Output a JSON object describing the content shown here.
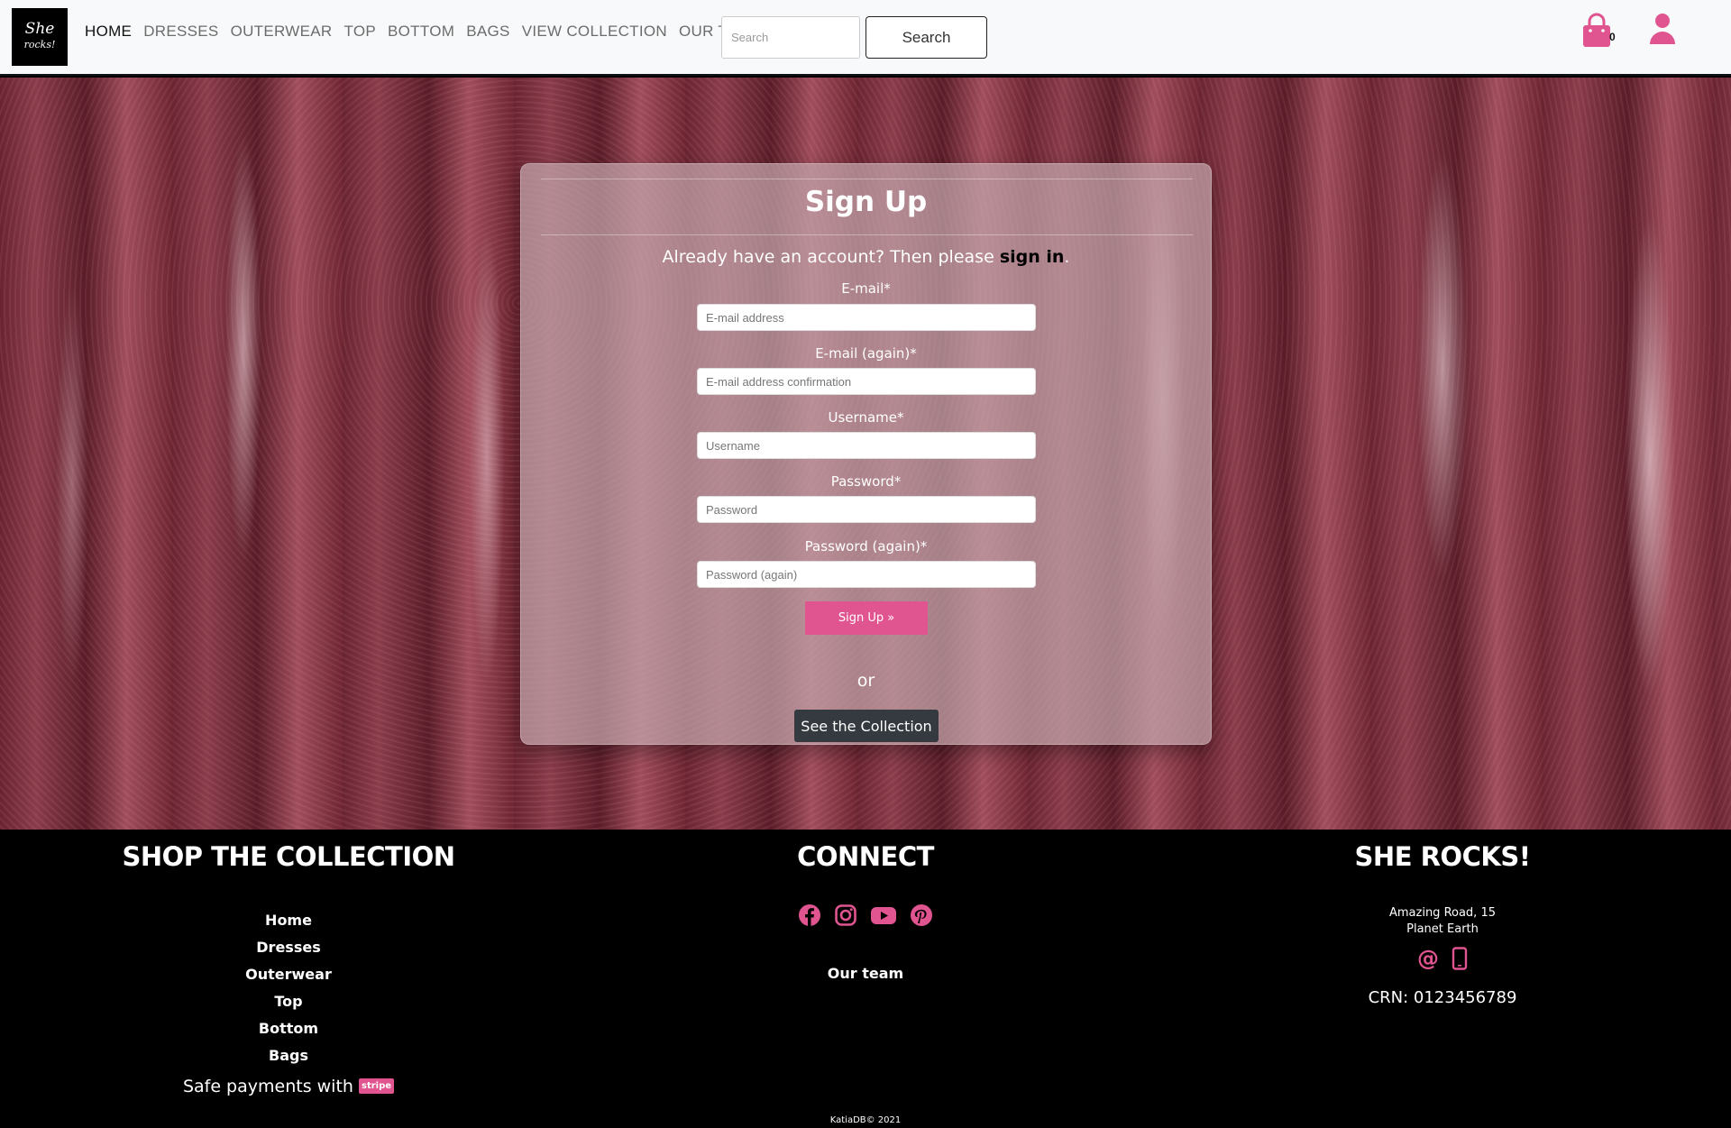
{
  "nav": {
    "logo_text_1": "She",
    "logo_text_2": "rocks!",
    "links": [
      "Home",
      "Dresses",
      "Outerwear",
      "Top",
      "Bottom",
      "Bags",
      "View Collection",
      "Our Team"
    ],
    "search_placeholder": "Search",
    "search_button": "Search",
    "bag_count": "0",
    "accent_color": "#e0548f"
  },
  "form": {
    "title": "Sign Up",
    "subtitle_prefix": "Already have an account? Then please ",
    "subtitle_link": "sign in",
    "subtitle_suffix": ".",
    "fields": [
      {
        "label": "E-mail*",
        "placeholder": "E-mail address"
      },
      {
        "label": "E-mail (again)*",
        "placeholder": "E-mail address confirmation"
      },
      {
        "label": "Username*",
        "placeholder": "Username"
      },
      {
        "label": "Password*",
        "placeholder": "Password"
      },
      {
        "label": "Password (again)*",
        "placeholder": "Password (again)"
      }
    ],
    "signup_button": "Sign Up »",
    "or": "or",
    "collection_button": "See the Collection"
  },
  "footer": {
    "shop_heading": "SHOP THE COLLECTION",
    "shop_links": [
      "Home",
      "Dresses",
      "Outerwear",
      "Top",
      "Bottom",
      "Bags"
    ],
    "safe_payments": "Safe payments with",
    "stripe": "stripe",
    "connect_heading": "CONNECT",
    "social_icons": [
      "facebook-icon",
      "instagram-icon",
      "youtube-icon",
      "pinterest-icon"
    ],
    "our_team": "Our team",
    "brand_heading": "SHE ROCKS!",
    "address_line_1": "Amazing Road, 15",
    "address_line_2": "Planet Earth",
    "contact_icons": [
      "at-sign-icon",
      "mobile-phone-icon"
    ],
    "crn": "CRN: 0123456789",
    "copyright": "KatiaDB© 2021"
  }
}
